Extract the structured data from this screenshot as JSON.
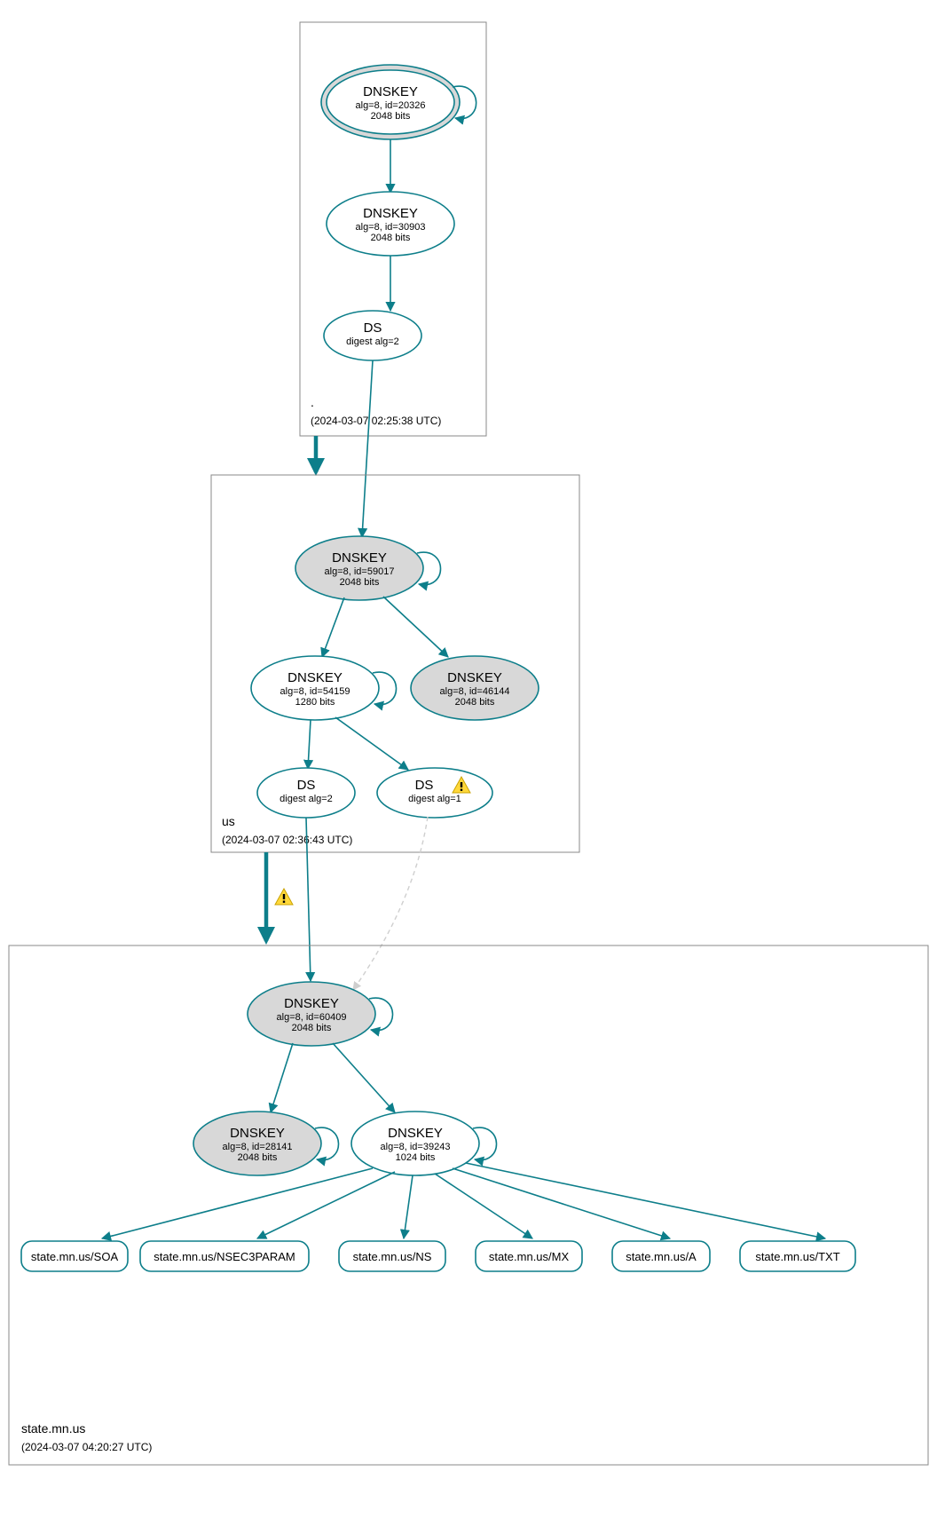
{
  "colors": {
    "stroke": "#0d7e8a",
    "fill_grey": "#d8d8d8",
    "box": "#888888",
    "dashed": "#cfcfcf"
  },
  "zones": {
    "root": {
      "name": ".",
      "timestamp": "(2024-03-07 02:25:38 UTC)",
      "nodes": {
        "ksk": {
          "title": "DNSKEY",
          "line1": "alg=8, id=20326",
          "line2": "2048 bits"
        },
        "zsk": {
          "title": "DNSKEY",
          "line1": "alg=8, id=30903",
          "line2": "2048 bits"
        },
        "ds": {
          "title": "DS",
          "line1": "digest alg=2"
        }
      }
    },
    "us": {
      "name": "us",
      "timestamp": "(2024-03-07 02:36:43 UTC)",
      "nodes": {
        "ksk": {
          "title": "DNSKEY",
          "line1": "alg=8, id=59017",
          "line2": "2048 bits"
        },
        "zsk": {
          "title": "DNSKEY",
          "line1": "alg=8, id=54159",
          "line2": "1280 bits"
        },
        "key2": {
          "title": "DNSKEY",
          "line1": "alg=8, id=46144",
          "line2": "2048 bits"
        },
        "ds1": {
          "title": "DS",
          "line1": "digest alg=2"
        },
        "ds2": {
          "title": "DS",
          "line1": "digest alg=1"
        }
      }
    },
    "statemnus": {
      "name": "state.mn.us",
      "timestamp": "(2024-03-07 04:20:27 UTC)",
      "nodes": {
        "ksk": {
          "title": "DNSKEY",
          "line1": "alg=8, id=60409",
          "line2": "2048 bits"
        },
        "key2": {
          "title": "DNSKEY",
          "line1": "alg=8, id=28141",
          "line2": "2048 bits"
        },
        "zsk": {
          "title": "DNSKEY",
          "line1": "alg=8, id=39243",
          "line2": "1024 bits"
        }
      },
      "rrsets": {
        "soa": "state.mn.us/SOA",
        "nsec3": "state.mn.us/NSEC3PARAM",
        "ns": "state.mn.us/NS",
        "mx": "state.mn.us/MX",
        "a": "state.mn.us/A",
        "txt": "state.mn.us/TXT"
      }
    }
  },
  "warnings": {
    "ds_alg1": "warning-icon",
    "delegation": "warning-icon"
  }
}
